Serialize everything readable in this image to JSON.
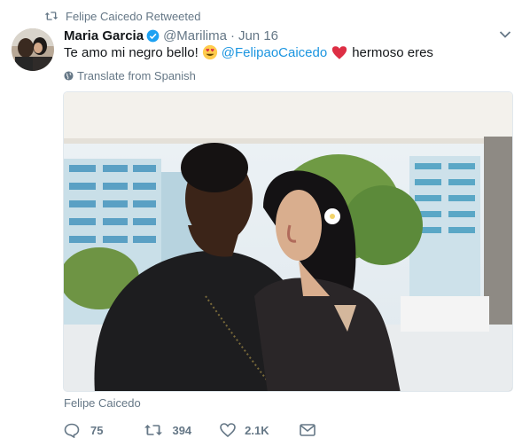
{
  "retweet_context": {
    "icon": "retweet-icon",
    "text": "Felipe Caicedo Retweeted"
  },
  "author": {
    "name": "Maria Garcia",
    "verified": true,
    "handle": "@Marilima",
    "separator": "·",
    "date": "Jun 16",
    "avatar_icon": "avatar-photo"
  },
  "tweet": {
    "text_before": "Te amo mi negro bello!",
    "emoji_icon": "heart-eyes-emoji",
    "mention": "@FelipaoCaicedo",
    "heart_icon": "red-heart-emoji",
    "text_after": "hermoso eres"
  },
  "translate": {
    "icon": "globe-icon",
    "label": "Translate from Spanish"
  },
  "media": {
    "type": "photo"
  },
  "tagged_user": "Felipe Caicedo",
  "actions": {
    "reply_count": "75",
    "retweet_count": "394",
    "like_count": "2.1K"
  },
  "colors": {
    "text": "#14171a",
    "secondary": "#657786",
    "link": "#1b95e0",
    "verified": "#1da1f2",
    "heart": "#e0245e"
  }
}
